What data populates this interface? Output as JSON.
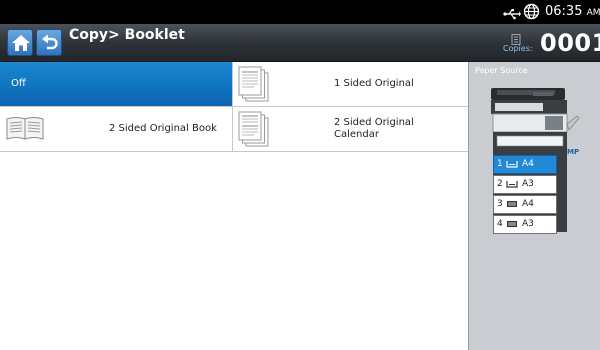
{
  "status": {
    "time": "06:35",
    "ampm": "AM",
    "icons": [
      "usb-icon",
      "globe-icon"
    ]
  },
  "header": {
    "title": "Copy> Booklet",
    "copies_label": "Copies:",
    "copies_count": "0001",
    "icons": [
      "home-icon",
      "back-icon",
      "copies-icon"
    ]
  },
  "options": [
    {
      "label": "Off",
      "selected": true,
      "icon": ""
    },
    {
      "label": "1 Sided Original",
      "selected": false,
      "icon": "one-sided-pages-icon"
    },
    {
      "label": "2 Sided Original Book",
      "selected": false,
      "icon": "open-book-icon"
    },
    {
      "label_line1": "2 Sided Original",
      "label_line2": "Calendar",
      "selected": false,
      "icon": "calendar-pages-icon"
    }
  ],
  "paper_source": {
    "title": "Paper Source",
    "mp_label": "MP",
    "trays": [
      {
        "number": "1",
        "size": "A4",
        "selected": true,
        "icon": "paper-tray-icon"
      },
      {
        "number": "2",
        "size": "A3",
        "selected": false,
        "icon": "paper-tray-icon"
      },
      {
        "number": "3",
        "size": "A4",
        "selected": false,
        "icon": "paper-stack-icon"
      },
      {
        "number": "4",
        "size": "A3",
        "selected": false,
        "icon": "paper-stack-icon"
      }
    ]
  },
  "colors": {
    "accent": "#0a64b2",
    "title_bar": "#2f343a",
    "panel": "#c9cdd2"
  }
}
